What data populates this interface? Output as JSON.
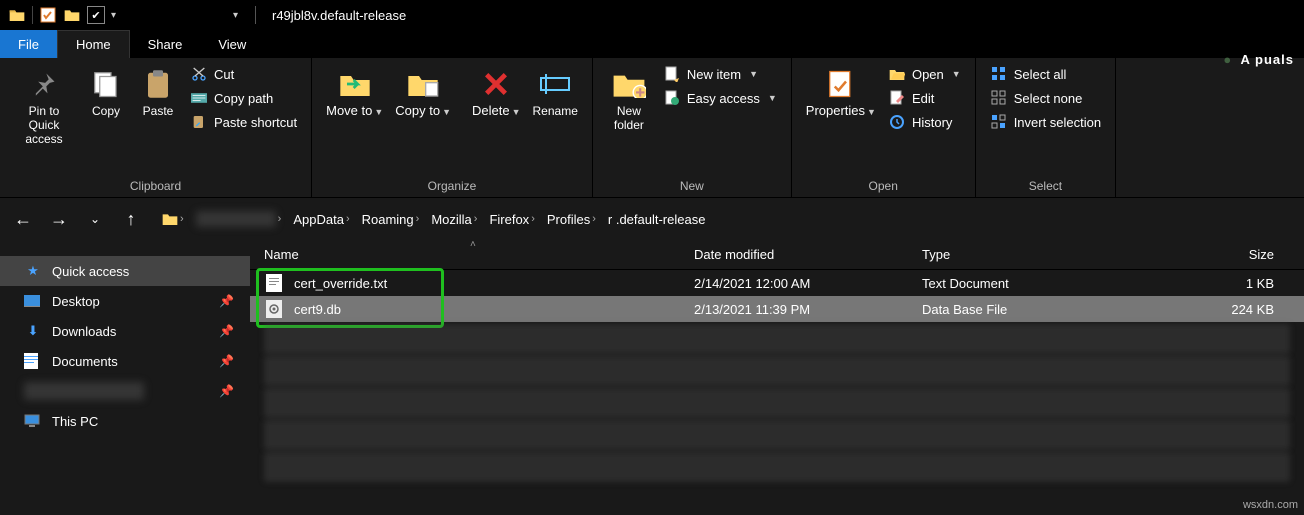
{
  "window": {
    "title": "r49jbl8v.default-release"
  },
  "menu": {
    "file": "File",
    "home": "Home",
    "share": "Share",
    "view": "View"
  },
  "ribbon": {
    "clipboard": {
      "label": "Clipboard",
      "pin": "Pin to Quick access",
      "copy": "Copy",
      "paste": "Paste",
      "cut": "Cut",
      "copy_path": "Copy path",
      "paste_shortcut": "Paste shortcut"
    },
    "organize": {
      "label": "Organize",
      "move_to": "Move to",
      "copy_to": "Copy to",
      "delete": "Delete",
      "rename": "Rename"
    },
    "new": {
      "label": "New",
      "new_folder": "New folder",
      "new_item": "New item",
      "easy_access": "Easy access"
    },
    "open": {
      "label": "Open",
      "properties": "Properties",
      "open": "Open",
      "edit": "Edit",
      "history": "History"
    },
    "select": {
      "label": "Select",
      "select_all": "Select all",
      "select_none": "Select none",
      "invert": "Invert selection"
    }
  },
  "breadcrumb": {
    "items": [
      "",
      "AppData",
      "Roaming",
      "Mozilla",
      "Firefox",
      "Profiles",
      "r       .default-release"
    ]
  },
  "sidebar": {
    "quick_access": "Quick access",
    "desktop": "Desktop",
    "downloads": "Downloads",
    "documents": "Documents",
    "this_pc": "This PC"
  },
  "columns": {
    "name": "Name",
    "date": "Date modified",
    "type": "Type",
    "size": "Size"
  },
  "files": [
    {
      "name": "cert_override.txt",
      "date": "2/14/2021 12:00 AM",
      "type": "Text Document",
      "size": "1 KB",
      "selected": false
    },
    {
      "name": "cert9.db",
      "date": "2/13/2021 11:39 PM",
      "type": "Data Base File",
      "size": "224 KB",
      "selected": true
    }
  ],
  "watermark": "wsxdn.com",
  "brand": "A puals"
}
